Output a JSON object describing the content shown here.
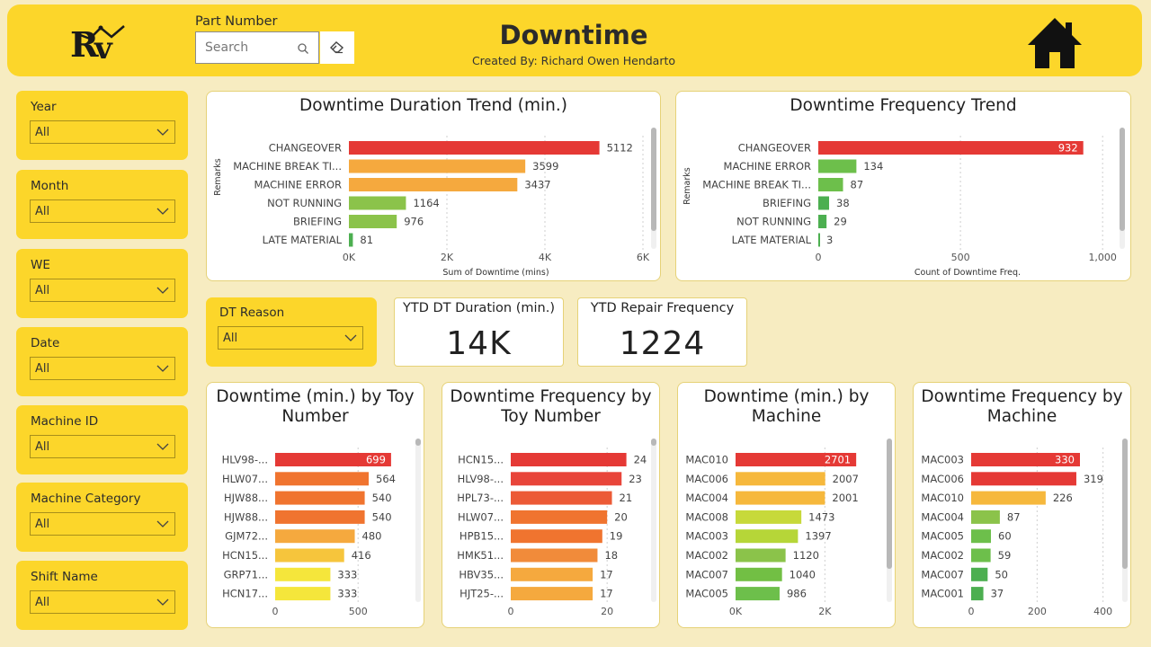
{
  "header": {
    "title": "Downtime",
    "subtitle": "Created By: Richard Owen Hendarto",
    "logo_icon": "rv-logo",
    "home_icon": "home-icon",
    "bg_color": "#fcd62a"
  },
  "search": {
    "label": "Part Number",
    "placeholder": "Search",
    "value": ""
  },
  "slicers": [
    {
      "label": "Year",
      "value": "All"
    },
    {
      "label": "Month",
      "value": "All"
    },
    {
      "label": "WE",
      "value": "All"
    },
    {
      "label": "Date",
      "value": "All"
    },
    {
      "label": "Machine ID",
      "value": "All"
    },
    {
      "label": "Machine Category",
      "value": "All"
    },
    {
      "label": "Shift Name",
      "value": "All"
    }
  ],
  "dt_reason": {
    "label": "DT Reason",
    "value": "All"
  },
  "kpis": [
    {
      "title": "YTD DT Duration (min.)",
      "value": "14K"
    },
    {
      "title": "YTD Repair Frequency",
      "value": "1224"
    }
  ],
  "chart_data": [
    {
      "type": "bar",
      "orientation": "horizontal",
      "title": "Downtime Duration Trend (min.)",
      "ylabel": "Remarks",
      "xlabel": "Sum of Downtime (mins)",
      "categories": [
        "CHANGEOVER",
        "MACHINE BREAK TI...",
        "MACHINE ERROR",
        "NOT RUNNING",
        "BRIEFING",
        "LATE MATERIAL"
      ],
      "values": [
        5112,
        3599,
        3437,
        1164,
        976,
        81
      ],
      "colors": [
        "#e53935",
        "#f5a93e",
        "#f5a93e",
        "#8bc34a",
        "#8bc34a",
        "#4caf50"
      ],
      "value_labels": [
        "5112",
        "3599",
        "3437",
        "1164",
        "976",
        "81"
      ],
      "inside_label": [
        false,
        false,
        false,
        false,
        false,
        false
      ],
      "xlim": [
        0,
        6000
      ],
      "ticks": [
        0,
        2000,
        4000,
        6000
      ],
      "tick_labels": [
        "0K",
        "2K",
        "4K",
        "6K"
      ],
      "grid": true
    },
    {
      "type": "bar",
      "orientation": "horizontal",
      "title": "Downtime Frequency Trend",
      "ylabel": "Remarks",
      "xlabel": "Count of Downtime Freq.",
      "categories": [
        "CHANGEOVER",
        "MACHINE ERROR",
        "MACHINE BREAK TI...",
        "BRIEFING",
        "NOT RUNNING",
        "LATE MATERIAL"
      ],
      "values": [
        932,
        134,
        87,
        38,
        29,
        3
      ],
      "colors": [
        "#e53935",
        "#6dbf4b",
        "#6dbf4b",
        "#4caf50",
        "#4caf50",
        "#4caf50"
      ],
      "value_labels": [
        "932",
        "134",
        "87",
        "38",
        "29",
        "3"
      ],
      "inside_label": [
        true,
        false,
        false,
        false,
        false,
        false
      ],
      "xlim": [
        0,
        1050
      ],
      "ticks": [
        0,
        500,
        1000
      ],
      "tick_labels": [
        "0",
        "500",
        "1,000"
      ],
      "grid": true
    },
    {
      "type": "bar",
      "orientation": "horizontal",
      "title": "Downtime (min.) by Toy Number",
      "categories": [
        "HLV98-...",
        "HLW07...",
        "HJW88...",
        "HJW88...",
        "GJM72...",
        "HCN15...",
        "GRP71...",
        "HCN17..."
      ],
      "values": [
        699,
        564,
        540,
        540,
        480,
        416,
        333,
        333
      ],
      "colors": [
        "#e53935",
        "#f0742f",
        "#f0742f",
        "#f0742f",
        "#f5a93e",
        "#f6c53c",
        "#f5e63b",
        "#f5e63b"
      ],
      "value_labels": [
        "699",
        "564",
        "540",
        "540",
        "480",
        "416",
        "333",
        "333"
      ],
      "inside_label": [
        true,
        false,
        false,
        false,
        false,
        false,
        false,
        false
      ],
      "xlim": [
        0,
        770
      ],
      "ticks": [
        0,
        500
      ],
      "tick_labels": [
        "0",
        "500"
      ],
      "grid": true
    },
    {
      "type": "bar",
      "orientation": "horizontal",
      "title": "Downtime Frequency by Toy Number",
      "categories": [
        "HCN15...",
        "HLV98-...",
        "HPL73-...",
        "HLW07...",
        "HPB15...",
        "HMK51...",
        "HBV35...",
        "HJT25-..."
      ],
      "values": [
        24,
        23,
        21,
        20,
        19,
        18,
        17,
        17
      ],
      "colors": [
        "#e53935",
        "#e8453a",
        "#ec5a36",
        "#f0742f",
        "#f0742f",
        "#f18b3a",
        "#f5a93e",
        "#f5a93e"
      ],
      "value_labels": [
        "24",
        "23",
        "21",
        "20",
        "19",
        "18",
        "17",
        "17"
      ],
      "inside_label": [
        false,
        false,
        false,
        false,
        false,
        false,
        false,
        false
      ],
      "xlim": [
        0,
        26.5
      ],
      "ticks": [
        0,
        20
      ],
      "tick_labels": [
        "0",
        "20"
      ],
      "grid": true
    },
    {
      "type": "bar",
      "orientation": "horizontal",
      "title": "Downtime (min.) by Machine",
      "categories": [
        "MAC010",
        "MAC006",
        "MAC004",
        "MAC008",
        "MAC003",
        "MAC002",
        "MAC007",
        "MAC005"
      ],
      "values": [
        2701,
        2007,
        2001,
        1473,
        1397,
        1120,
        1040,
        986
      ],
      "colors": [
        "#e53935",
        "#f6b83c",
        "#f6b83c",
        "#c7d93a",
        "#b6d638",
        "#8bc34a",
        "#72bf44",
        "#6dbf4b"
      ],
      "value_labels": [
        "2701",
        "2007",
        "2001",
        "1473",
        "1397",
        "1120",
        "1040",
        "986"
      ],
      "inside_label": [
        true,
        false,
        false,
        false,
        false,
        false,
        false,
        false
      ],
      "xlim": [
        0,
        3000
      ],
      "ticks": [
        0,
        2000
      ],
      "tick_labels": [
        "0K",
        "2K"
      ],
      "grid": true
    },
    {
      "type": "bar",
      "orientation": "horizontal",
      "title": "Downtime Frequency by Machine",
      "categories": [
        "MAC003",
        "MAC006",
        "MAC010",
        "MAC004",
        "MAC005",
        "MAC002",
        "MAC007",
        "MAC001"
      ],
      "values": [
        330,
        319,
        226,
        87,
        60,
        59,
        50,
        37
      ],
      "colors": [
        "#e53935",
        "#e53935",
        "#f6b83c",
        "#8bc34a",
        "#6dbf4b",
        "#6dbf4b",
        "#4caf50",
        "#4caf50"
      ],
      "value_labels": [
        "330",
        "319",
        "226",
        "87",
        "60",
        "59",
        "50",
        "37"
      ],
      "inside_label": [
        true,
        false,
        false,
        false,
        false,
        false,
        false,
        false
      ],
      "xlim": [
        0,
        420
      ],
      "ticks": [
        0,
        200,
        400
      ],
      "tick_labels": [
        "0",
        "200",
        "400"
      ],
      "grid": true
    }
  ]
}
